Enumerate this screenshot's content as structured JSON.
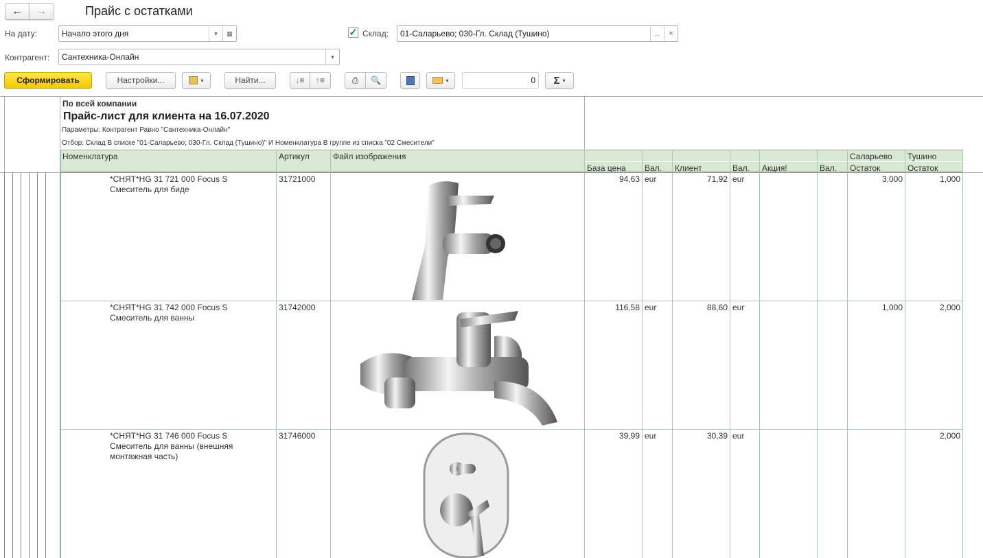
{
  "window": {
    "title": "Прайс с остатками"
  },
  "form": {
    "date_label": "На дату:",
    "date_value": "Начало этого дня",
    "warehouse_checkbox_checked": true,
    "warehouse_label": "Склад:",
    "warehouse_value": "01-Саларьево; 030-Гл. Склад (Тушино)",
    "counterparty_label": "Контрагент:",
    "counterparty_value": "Сантехника-Онлайн"
  },
  "toolbar": {
    "generate": "Сформировать",
    "settings": "Настройки...",
    "find": "Найти...",
    "sum_value": "0",
    "sigma": "Σ",
    "ellipsis": "...",
    "clear": "×"
  },
  "report": {
    "company": "По всей компании",
    "title": "Прайс-лист для клиента на 16.07.2020",
    "params": "Параметры: Контрагент Равно \"Сантехника-Онлайн\"",
    "filter": "Отбор: Склад В списке \"01-Саларьево; 030-Гл. Склад (Тушино)\" И Номенклатура В группе из списка \"02 Смесители\"",
    "headers": {
      "nomenclature": "Номенклатура",
      "article": "Артикул",
      "image": "Файл изображения",
      "base_price": "База цена",
      "cur1": "Вал.",
      "client": "Клиент",
      "cur2": "Вал.",
      "promo": "Акция!",
      "cur3": "Вал.",
      "wh1": "Саларьево",
      "wh1_sub": "Остаток",
      "wh2": "Тушино",
      "wh2_sub": "Остаток"
    },
    "rows": [
      {
        "name1": "*СНЯТ*HG    31 721 000 Focus S",
        "name2": "Смеситель для биде",
        "name3": "",
        "article": "31721000",
        "base": "94,63",
        "cur1": "eur",
        "client": "71,92",
        "cur2": "eur",
        "promo": "",
        "cur3": "",
        "wh1": "3,000",
        "wh2": "1,000"
      },
      {
        "name1": "*СНЯТ*HG    31 742 000 Focus S",
        "name2": "Смеситель для ванны",
        "name3": "",
        "article": "31742000",
        "base": "116,58",
        "cur1": "eur",
        "client": "88,60",
        "cur2": "eur",
        "promo": "",
        "cur3": "",
        "wh1": "1,000",
        "wh2": "2,000"
      },
      {
        "name1": "*СНЯТ*HG    31 746 000 Focus S",
        "name2": "Смеситель для ванны (внешняя",
        "name3": "монтажная часть)",
        "article": "31746000",
        "base": "39,99",
        "cur1": "eur",
        "client": "30,39",
        "cur2": "eur",
        "promo": "",
        "cur3": "",
        "wh1": "",
        "wh2": "2,000"
      }
    ]
  }
}
